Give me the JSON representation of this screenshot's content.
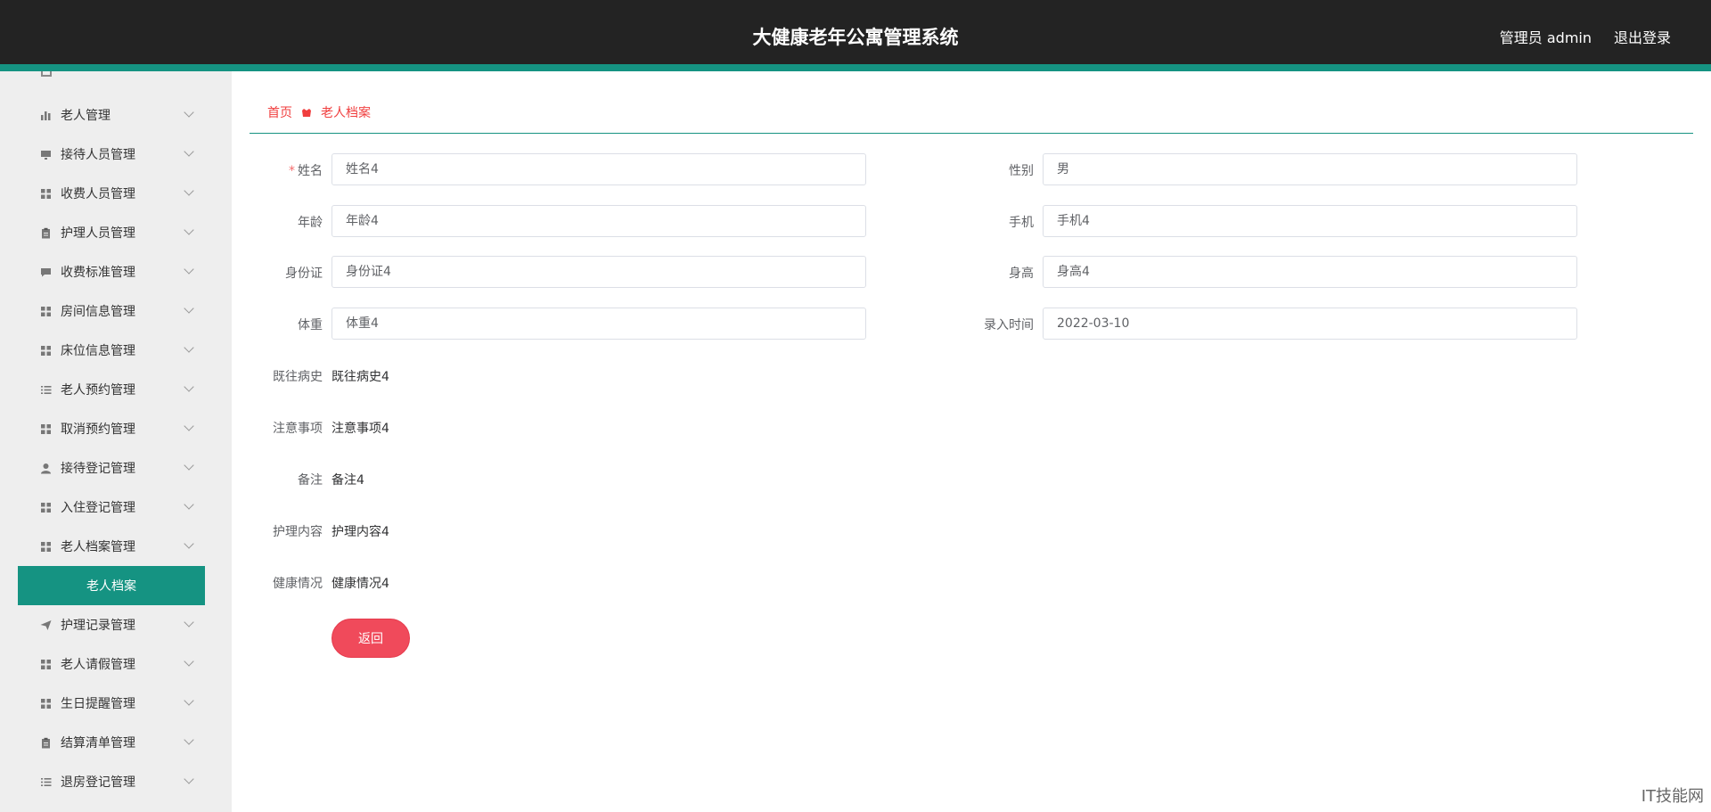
{
  "header": {
    "title": "大健康老年公寓管理系统",
    "user": "管理员 admin",
    "logout": "退出登录"
  },
  "sidebar": {
    "items": [
      {
        "label": "老人管理",
        "icon": "bar-chart-icon"
      },
      {
        "label": "接待人员管理",
        "icon": "monitor-icon"
      },
      {
        "label": "收费人员管理",
        "icon": "grid-icon"
      },
      {
        "label": "护理人员管理",
        "icon": "clipboard-icon"
      },
      {
        "label": "收费标准管理",
        "icon": "chat-icon"
      },
      {
        "label": "房间信息管理",
        "icon": "grid-icon"
      },
      {
        "label": "床位信息管理",
        "icon": "grid-icon"
      },
      {
        "label": "老人预约管理",
        "icon": "list-icon"
      },
      {
        "label": "取消预约管理",
        "icon": "grid-icon"
      },
      {
        "label": "接待登记管理",
        "icon": "user-icon"
      },
      {
        "label": "入住登记管理",
        "icon": "grid-icon"
      },
      {
        "label": "老人档案管理",
        "icon": "grid-icon"
      }
    ],
    "active_sub": "老人档案",
    "items_after": [
      {
        "label": "护理记录管理",
        "icon": "send-icon"
      },
      {
        "label": "老人请假管理",
        "icon": "grid-icon"
      },
      {
        "label": "生日提醒管理",
        "icon": "grid-icon"
      },
      {
        "label": "结算清单管理",
        "icon": "clipboard-icon"
      },
      {
        "label": "退房登记管理",
        "icon": "list-icon"
      }
    ]
  },
  "breadcrumb": {
    "home": "首页",
    "current": "老人档案"
  },
  "form": {
    "name_label": "姓名",
    "name_value": "姓名4",
    "gender_label": "性别",
    "gender_value": "男",
    "age_label": "年龄",
    "age_value": "年龄4",
    "phone_label": "手机",
    "phone_value": "手机4",
    "idcard_label": "身份证",
    "idcard_value": "身份证4",
    "height_label": "身高",
    "height_value": "身高4",
    "weight_label": "体重",
    "weight_value": "体重4",
    "entry_time_label": "录入时间",
    "entry_time_value": "2022-03-10",
    "history_label": "既往病史",
    "history_value": "既往病史4",
    "notes_label": "注意事项",
    "notes_value": "注意事项4",
    "remark_label": "备注",
    "remark_value": "备注4",
    "care_label": "护理内容",
    "care_value": "护理内容4",
    "health_label": "健康情况",
    "health_value": "健康情况4",
    "back_label": "返回"
  },
  "watermark": "IT技能网",
  "colors": {
    "accent": "#159382",
    "header_bg": "#232323",
    "breadcrumb": "#f03e3e",
    "back_button": "#f04a5b"
  }
}
